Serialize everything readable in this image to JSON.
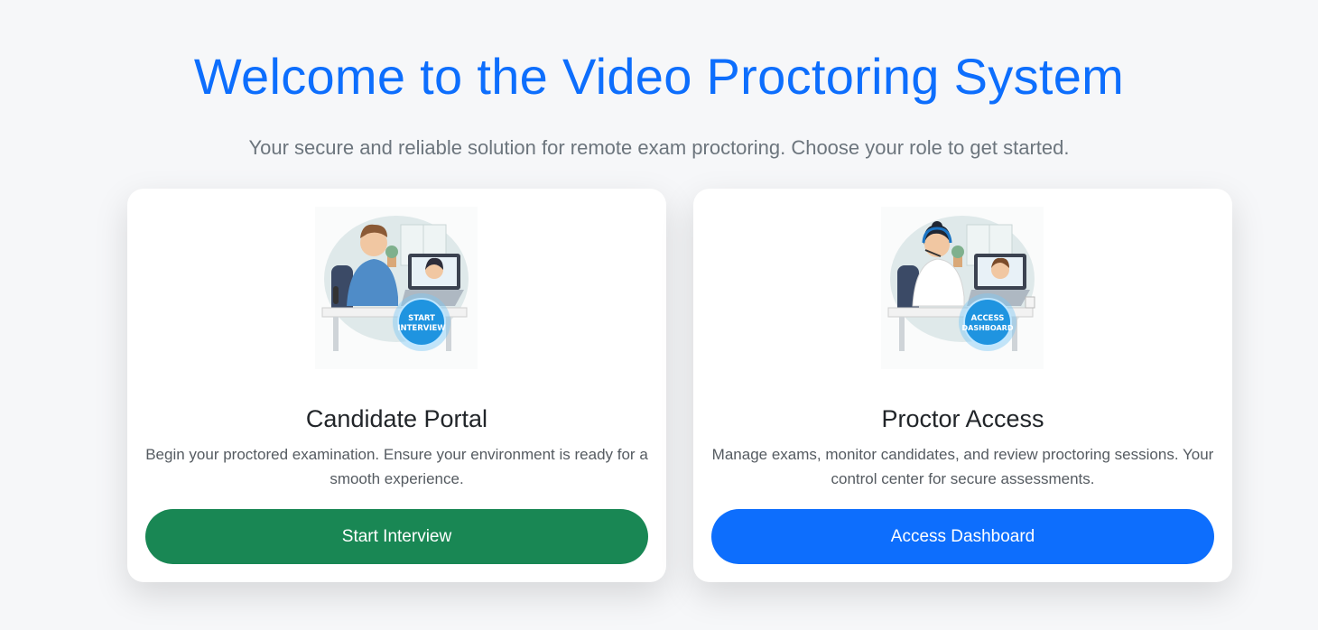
{
  "header": {
    "title": "Welcome to the Video Proctoring System",
    "subtitle": "Your secure and reliable solution for remote exam proctoring. Choose your role to get started."
  },
  "cards": [
    {
      "title": "Candidate Portal",
      "description": "Begin your proctored examination. Ensure your environment is ready for a smooth experience.",
      "button_label": "Start Interview",
      "badge_line1": "START",
      "badge_line2": "INTERVIEW",
      "button_color": "#198754"
    },
    {
      "title": "Proctor Access",
      "description": "Manage exams, monitor candidates, and review proctoring sessions. Your control center for secure assessments.",
      "button_label": "Access Dashboard",
      "badge_line1": "ACCESS",
      "badge_line2": "DASHBOARD",
      "button_color": "#0d6efd"
    }
  ],
  "colors": {
    "accent": "#0d6efd",
    "success": "#198754",
    "background": "#f6f7f9"
  }
}
